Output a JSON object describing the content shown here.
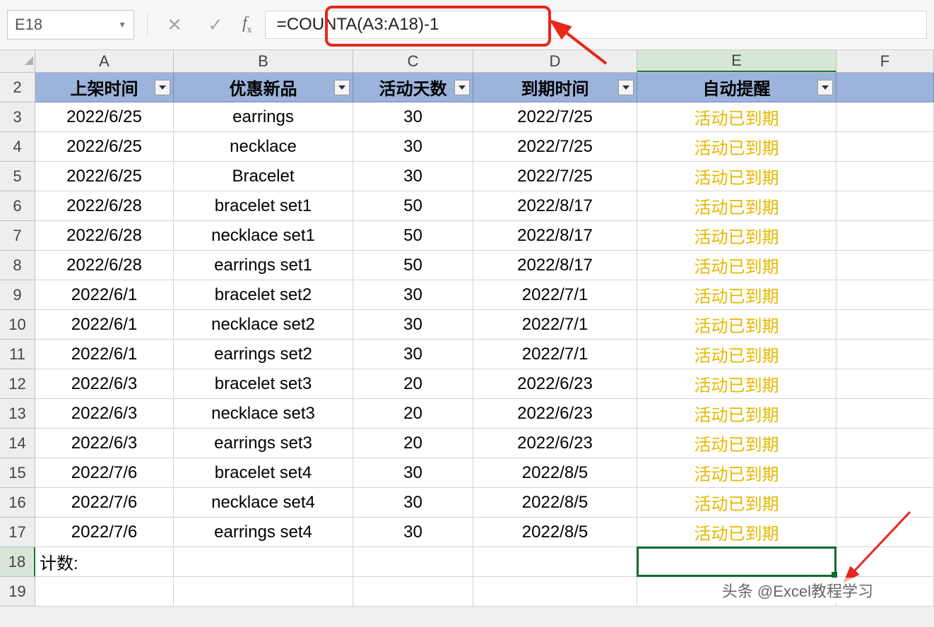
{
  "formula_bar": {
    "cell_ref": "E18",
    "cancel_icon": "✕",
    "accept_icon": "✓",
    "fx_label": "fx",
    "formula": "=COUNTA(A3:A18)-1"
  },
  "columns": {
    "labels": [
      "A",
      "B",
      "C",
      "D",
      "E",
      "F"
    ],
    "widths": [
      196,
      254,
      170,
      232,
      282,
      138
    ],
    "selected": 4
  },
  "headers": [
    "上架时间",
    "优惠新品",
    "活动天数",
    "到期时间",
    "自动提醒"
  ],
  "rows": [
    {
      "n": 3,
      "a": "2022/6/25",
      "b": "earrings",
      "c": "30",
      "d": "2022/7/25",
      "e": "活动已到期"
    },
    {
      "n": 4,
      "a": "2022/6/25",
      "b": "necklace",
      "c": "30",
      "d": "2022/7/25",
      "e": "活动已到期"
    },
    {
      "n": 5,
      "a": "2022/6/25",
      "b": "Bracelet",
      "c": "30",
      "d": "2022/7/25",
      "e": "活动已到期"
    },
    {
      "n": 6,
      "a": "2022/6/28",
      "b": "bracelet set1",
      "c": "50",
      "d": "2022/8/17",
      "e": "活动已到期"
    },
    {
      "n": 7,
      "a": "2022/6/28",
      "b": "necklace set1",
      "c": "50",
      "d": "2022/8/17",
      "e": "活动已到期"
    },
    {
      "n": 8,
      "a": "2022/6/28",
      "b": "earrings set1",
      "c": "50",
      "d": "2022/8/17",
      "e": "活动已到期"
    },
    {
      "n": 9,
      "a": "2022/6/1",
      "b": "bracelet set2",
      "c": "30",
      "d": "2022/7/1",
      "e": "活动已到期"
    },
    {
      "n": 10,
      "a": "2022/6/1",
      "b": "necklace set2",
      "c": "30",
      "d": "2022/7/1",
      "e": "活动已到期"
    },
    {
      "n": 11,
      "a": "2022/6/1",
      "b": "earrings set2",
      "c": "30",
      "d": "2022/7/1",
      "e": "活动已到期"
    },
    {
      "n": 12,
      "a": "2022/6/3",
      "b": "bracelet set3",
      "c": "20",
      "d": "2022/6/23",
      "e": "活动已到期"
    },
    {
      "n": 13,
      "a": "2022/6/3",
      "b": "necklace set3",
      "c": "20",
      "d": "2022/6/23",
      "e": "活动已到期"
    },
    {
      "n": 14,
      "a": "2022/6/3",
      "b": "earrings set3",
      "c": "20",
      "d": "2022/6/23",
      "e": "活动已到期"
    },
    {
      "n": 15,
      "a": "2022/7/6",
      "b": "bracelet set4",
      "c": "30",
      "d": "2022/8/5",
      "e": "活动已到期"
    },
    {
      "n": 16,
      "a": "2022/7/6",
      "b": "necklace set4",
      "c": "30",
      "d": "2022/8/5",
      "e": "活动已到期"
    },
    {
      "n": 17,
      "a": "2022/7/6",
      "b": "earrings set4",
      "c": "30",
      "d": "2022/8/5",
      "e": "活动已到期"
    }
  ],
  "sum_row": {
    "n": 18,
    "label": "计数:",
    "selected": true
  },
  "extra_row": {
    "n": 19
  },
  "watermark": "头条 @Excel教程学习"
}
